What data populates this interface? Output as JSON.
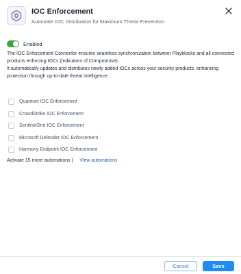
{
  "header": {
    "title": "IOC Enforcement",
    "subtitle": "Automate IOC Distribution for Maximum Threat Prevention",
    "logo_icon": "shield-hexagon-icon",
    "close_icon": "close-icon"
  },
  "toggle": {
    "label": "Enabled",
    "on": true,
    "color": "#3aa640"
  },
  "description": {
    "line1": "The IOC Enforcement Connector ensures seamless synchronization between Playblocks and all connected products enforcing IOCs (Indicators of Compromise).",
    "line2": "It automatically updates and distributes newly added IOCs across your security products, enhancing protection through up-to-date threat intelligence."
  },
  "automations": [
    {
      "label": "Quantum IOC Enforcement",
      "checked": false
    },
    {
      "label": "CrowdStrike IOC Enforcement",
      "checked": false
    },
    {
      "label": "SentinelOne IOC Enforcement",
      "checked": false
    },
    {
      "label": "Microsoft Defender IOC Enforcement",
      "checked": false
    },
    {
      "label": "Harmony Endpoint IOC Enforcement",
      "checked": false
    }
  ],
  "more": {
    "text": "Activate 15 more automations |",
    "link": "View automations"
  },
  "footer": {
    "cancel_label": "Cancel",
    "save_label": "Save",
    "primary_color": "#1e8cf0"
  }
}
